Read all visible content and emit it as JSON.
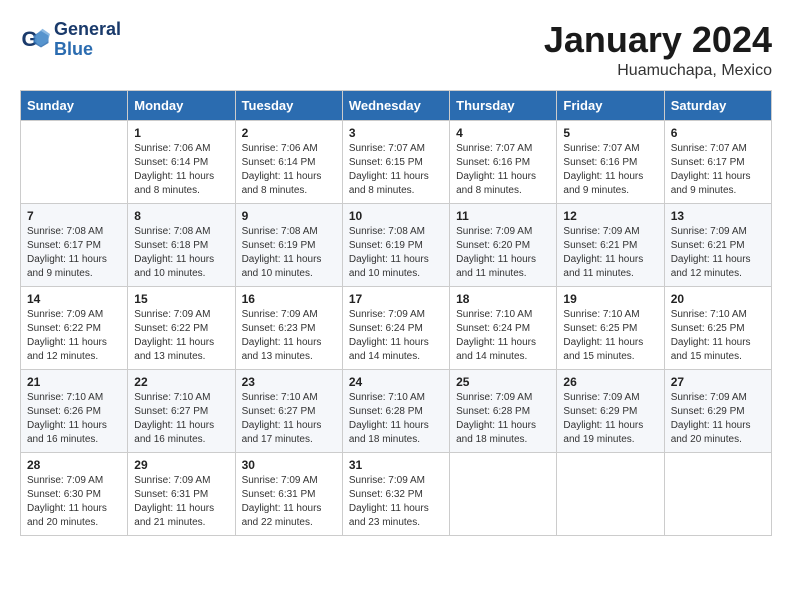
{
  "logo": {
    "line1": "General",
    "line2": "Blue"
  },
  "title": "January 2024",
  "location": "Huamuchapa, Mexico",
  "weekdays": [
    "Sunday",
    "Monday",
    "Tuesday",
    "Wednesday",
    "Thursday",
    "Friday",
    "Saturday"
  ],
  "weeks": [
    [
      {
        "day": "",
        "info": ""
      },
      {
        "day": "1",
        "info": "Sunrise: 7:06 AM\nSunset: 6:14 PM\nDaylight: 11 hours and 8 minutes."
      },
      {
        "day": "2",
        "info": "Sunrise: 7:06 AM\nSunset: 6:14 PM\nDaylight: 11 hours and 8 minutes."
      },
      {
        "day": "3",
        "info": "Sunrise: 7:07 AM\nSunset: 6:15 PM\nDaylight: 11 hours and 8 minutes."
      },
      {
        "day": "4",
        "info": "Sunrise: 7:07 AM\nSunset: 6:16 PM\nDaylight: 11 hours and 8 minutes."
      },
      {
        "day": "5",
        "info": "Sunrise: 7:07 AM\nSunset: 6:16 PM\nDaylight: 11 hours and 9 minutes."
      },
      {
        "day": "6",
        "info": "Sunrise: 7:07 AM\nSunset: 6:17 PM\nDaylight: 11 hours and 9 minutes."
      }
    ],
    [
      {
        "day": "7",
        "info": "Sunrise: 7:08 AM\nSunset: 6:17 PM\nDaylight: 11 hours and 9 minutes."
      },
      {
        "day": "8",
        "info": "Sunrise: 7:08 AM\nSunset: 6:18 PM\nDaylight: 11 hours and 10 minutes."
      },
      {
        "day": "9",
        "info": "Sunrise: 7:08 AM\nSunset: 6:19 PM\nDaylight: 11 hours and 10 minutes."
      },
      {
        "day": "10",
        "info": "Sunrise: 7:08 AM\nSunset: 6:19 PM\nDaylight: 11 hours and 10 minutes."
      },
      {
        "day": "11",
        "info": "Sunrise: 7:09 AM\nSunset: 6:20 PM\nDaylight: 11 hours and 11 minutes."
      },
      {
        "day": "12",
        "info": "Sunrise: 7:09 AM\nSunset: 6:21 PM\nDaylight: 11 hours and 11 minutes."
      },
      {
        "day": "13",
        "info": "Sunrise: 7:09 AM\nSunset: 6:21 PM\nDaylight: 11 hours and 12 minutes."
      }
    ],
    [
      {
        "day": "14",
        "info": "Sunrise: 7:09 AM\nSunset: 6:22 PM\nDaylight: 11 hours and 12 minutes."
      },
      {
        "day": "15",
        "info": "Sunrise: 7:09 AM\nSunset: 6:22 PM\nDaylight: 11 hours and 13 minutes."
      },
      {
        "day": "16",
        "info": "Sunrise: 7:09 AM\nSunset: 6:23 PM\nDaylight: 11 hours and 13 minutes."
      },
      {
        "day": "17",
        "info": "Sunrise: 7:09 AM\nSunset: 6:24 PM\nDaylight: 11 hours and 14 minutes."
      },
      {
        "day": "18",
        "info": "Sunrise: 7:10 AM\nSunset: 6:24 PM\nDaylight: 11 hours and 14 minutes."
      },
      {
        "day": "19",
        "info": "Sunrise: 7:10 AM\nSunset: 6:25 PM\nDaylight: 11 hours and 15 minutes."
      },
      {
        "day": "20",
        "info": "Sunrise: 7:10 AM\nSunset: 6:25 PM\nDaylight: 11 hours and 15 minutes."
      }
    ],
    [
      {
        "day": "21",
        "info": "Sunrise: 7:10 AM\nSunset: 6:26 PM\nDaylight: 11 hours and 16 minutes."
      },
      {
        "day": "22",
        "info": "Sunrise: 7:10 AM\nSunset: 6:27 PM\nDaylight: 11 hours and 16 minutes."
      },
      {
        "day": "23",
        "info": "Sunrise: 7:10 AM\nSunset: 6:27 PM\nDaylight: 11 hours and 17 minutes."
      },
      {
        "day": "24",
        "info": "Sunrise: 7:10 AM\nSunset: 6:28 PM\nDaylight: 11 hours and 18 minutes."
      },
      {
        "day": "25",
        "info": "Sunrise: 7:09 AM\nSunset: 6:28 PM\nDaylight: 11 hours and 18 minutes."
      },
      {
        "day": "26",
        "info": "Sunrise: 7:09 AM\nSunset: 6:29 PM\nDaylight: 11 hours and 19 minutes."
      },
      {
        "day": "27",
        "info": "Sunrise: 7:09 AM\nSunset: 6:29 PM\nDaylight: 11 hours and 20 minutes."
      }
    ],
    [
      {
        "day": "28",
        "info": "Sunrise: 7:09 AM\nSunset: 6:30 PM\nDaylight: 11 hours and 20 minutes."
      },
      {
        "day": "29",
        "info": "Sunrise: 7:09 AM\nSunset: 6:31 PM\nDaylight: 11 hours and 21 minutes."
      },
      {
        "day": "30",
        "info": "Sunrise: 7:09 AM\nSunset: 6:31 PM\nDaylight: 11 hours and 22 minutes."
      },
      {
        "day": "31",
        "info": "Sunrise: 7:09 AM\nSunset: 6:32 PM\nDaylight: 11 hours and 23 minutes."
      },
      {
        "day": "",
        "info": ""
      },
      {
        "day": "",
        "info": ""
      },
      {
        "day": "",
        "info": ""
      }
    ]
  ]
}
